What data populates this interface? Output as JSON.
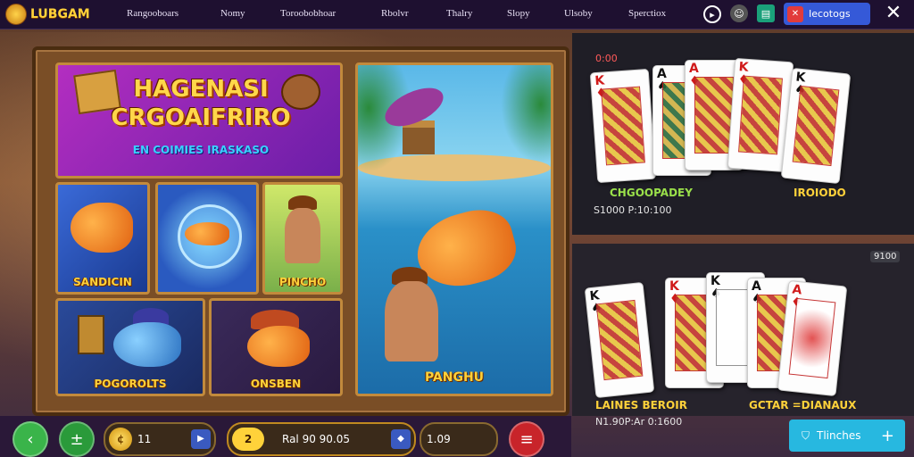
{
  "app": {
    "name": "LUBGAM"
  },
  "nav": {
    "items": [
      "Rangooboars",
      "Nomy",
      "Toroobobhoar",
      "Rbolvr",
      "Thalry",
      "Slopy",
      "Ulsoby",
      "Sperctiox"
    ]
  },
  "top_button": {
    "label": "Iecotogs",
    "icon": "close-badge-icon"
  },
  "title_panel": {
    "title_line1": "HAGENASI",
    "title_line2": "CRGOAIFRIRO",
    "subtitle": "EN COIMIES IRASKASO"
  },
  "tiles": [
    {
      "label": "SANDICIN"
    },
    {
      "label": ""
    },
    {
      "label": "PINCHO"
    },
    {
      "label": "POGOROLTS"
    },
    {
      "label": "ONSBEN"
    }
  ],
  "scene": {
    "label": "PANGHU"
  },
  "bottom": {
    "coins_value": "11",
    "bet_value": "2",
    "bet_text": "Ral 90 90.05",
    "balance_value": "1.09"
  },
  "right_top": {
    "timer": "0:00",
    "title": "CHGOOPADEY",
    "subtitle": "S1000 P:10:100",
    "label_right": "IROIODO",
    "cards": [
      {
        "rank": "K",
        "suit": "♦"
      },
      {
        "rank": "A",
        "suit": "♠"
      },
      {
        "rank": "A",
        "suit": "♦"
      },
      {
        "rank": "K",
        "suit": "♦"
      },
      {
        "rank": "K",
        "suit": "♠"
      }
    ]
  },
  "right_bottom": {
    "badge": "9100",
    "title": "LAINES BEROIR",
    "subtitle": "N1.90P:Ar 0:1600",
    "label_right": "GCTAR =DIANAUX",
    "cards": [
      {
        "rank": "K",
        "suit": "♠"
      },
      {
        "rank": "K",
        "suit": "♦"
      },
      {
        "rank": "K",
        "suit": "♠"
      },
      {
        "rank": "A",
        "suit": "♠"
      },
      {
        "rank": "A",
        "suit": "♦"
      }
    ]
  },
  "action_button": {
    "label": "Tlinches",
    "plus": "+"
  }
}
